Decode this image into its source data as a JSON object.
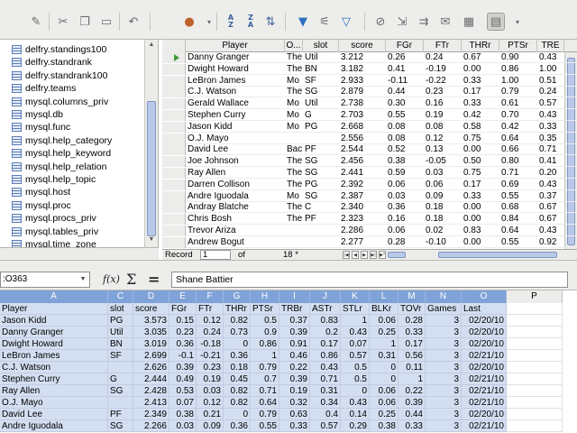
{
  "toolbar": {
    "buttons": [
      {
        "name": "edit-icon",
        "glyph": "✎"
      },
      {
        "name": "cut-icon",
        "glyph": "✂"
      },
      {
        "name": "copy-icon",
        "glyph": "❐"
      },
      {
        "name": "paste-icon",
        "glyph": "📋"
      },
      {
        "name": "undo-icon",
        "glyph": "↶"
      },
      {
        "name": "sort-ascending-icon",
        "glyph": "A↓Z"
      },
      {
        "name": "sort-descending-icon",
        "glyph": "Z↓A"
      },
      {
        "name": "sort-icon",
        "glyph": "⇅"
      },
      {
        "name": "autofilter-icon",
        "glyph": "⏷"
      },
      {
        "name": "standard-filter-icon",
        "glyph": "⏷"
      },
      {
        "name": "remove-filter-icon",
        "glyph": "⊘"
      },
      {
        "name": "toggle-navigator-icon",
        "glyph": "▤"
      }
    ]
  },
  "navigator": {
    "items": [
      "delfry.standings100",
      "delfry.standrank",
      "delfry.standrank100",
      "delfry.teams",
      "mysql.columns_priv",
      "mysql.db",
      "mysql.func",
      "mysql.help_category",
      "mysql.help_keyword",
      "mysql.help_relation",
      "mysql.help_topic",
      "mysql.host",
      "mysql.proc",
      "mysql.procs_priv",
      "mysql.tables_priv",
      "mysql.time_zone"
    ]
  },
  "topgrid": {
    "columns": [
      "Player",
      "O...",
      "slot",
      "score",
      "FGr",
      "FTr",
      "THRr",
      "PTSr",
      "TRE"
    ],
    "rows": [
      [
        "Danny Granger",
        "The",
        "Util",
        "3.212",
        "0.26",
        "0.24",
        "0.67",
        "0.90",
        "0.43"
      ],
      [
        "Dwight Howard",
        "The",
        "BN",
        "3.182",
        "0.41",
        "-0.19",
        "0.00",
        "0.86",
        "1.00"
      ],
      [
        "LeBron James",
        "Mo",
        "SF",
        "2.933",
        "-0.11",
        "-0.22",
        "0.33",
        "1.00",
        "0.51"
      ],
      [
        "C.J. Watson",
        "The",
        "SG",
        "2.879",
        "0.44",
        "0.23",
        "0.17",
        "0.79",
        "0.24"
      ],
      [
        "Gerald Wallace",
        "Mo",
        "Util",
        "2.738",
        "0.30",
        "0.16",
        "0.33",
        "0.61",
        "0.57"
      ],
      [
        "Stephen Curry",
        "Mo",
        "G",
        "2.703",
        "0.55",
        "0.19",
        "0.42",
        "0.70",
        "0.43"
      ],
      [
        "Jason Kidd",
        "Mo",
        "PG",
        "2.668",
        "0.08",
        "0.08",
        "0.58",
        "0.42",
        "0.33"
      ],
      [
        "O.J. Mayo",
        "",
        "",
        "2.556",
        "0.08",
        "0.12",
        "0.75",
        "0.64",
        "0.35"
      ],
      [
        "David Lee",
        "Bac",
        "PF",
        "2.544",
        "0.52",
        "0.13",
        "0.00",
        "0.66",
        "0.71"
      ],
      [
        "Joe Johnson",
        "The",
        "SG",
        "2.456",
        "0.38",
        "-0.05",
        "0.50",
        "0.80",
        "0.41"
      ],
      [
        "Ray Allen",
        "The",
        "SG",
        "2.441",
        "0.59",
        "0.03",
        "0.75",
        "0.71",
        "0.20"
      ],
      [
        "Darren Collison",
        "The",
        "PG",
        "2.392",
        "0.06",
        "0.06",
        "0.17",
        "0.69",
        "0.43"
      ],
      [
        "Andre Iguodala",
        "Mo",
        "SG",
        "2.387",
        "0.03",
        "0.09",
        "0.33",
        "0.55",
        "0.37"
      ],
      [
        "Andray Blatche",
        "The",
        "C",
        "2.340",
        "0.36",
        "0.18",
        "0.00",
        "0.68",
        "0.67"
      ],
      [
        "Chris Bosh",
        "The",
        "PF",
        "2.323",
        "0.16",
        "0.18",
        "0.00",
        "0.84",
        "0.67"
      ],
      [
        "Trevor Ariza",
        "",
        "",
        "2.286",
        "0.06",
        "0.02",
        "0.83",
        "0.64",
        "0.43"
      ],
      [
        "Andrew Bogut",
        "",
        "",
        "2.277",
        "0.28",
        "-0.10",
        "0.00",
        "0.55",
        "0.92"
      ]
    ],
    "status": {
      "record_label": "Record",
      "record_value": "1",
      "of_label": "of",
      "total": "18 *"
    }
  },
  "formula": {
    "namebox": ":O363",
    "fx": "f(x)",
    "sigma": "Σ",
    "equals": "=",
    "value": "Shane Battier"
  },
  "sheet": {
    "col_letters": [
      "A",
      "C",
      "D",
      "E",
      "F",
      "G",
      "H",
      "I",
      "J",
      "K",
      "L",
      "M",
      "N",
      "O",
      "P"
    ],
    "header_row": [
      "Player",
      "slot",
      "score",
      "FGr",
      "FTr",
      "THRr",
      "PTSr",
      "TRBr",
      "ASTr",
      "STLr",
      "BLKr",
      "TOVr",
      "Games",
      "Last"
    ],
    "rows": [
      [
        "Jason Kidd",
        "PG",
        "3.573",
        "0.15",
        "0.12",
        "0.82",
        "0.5",
        "0.37",
        "0.83",
        "1",
        "0.06",
        "0.28",
        "3",
        "02/20/10"
      ],
      [
        "Danny Granger",
        "Util",
        "3.035",
        "0.23",
        "0.24",
        "0.73",
        "0.9",
        "0.39",
        "0.2",
        "0.43",
        "0.25",
        "0.33",
        "3",
        "02/20/10"
      ],
      [
        "Dwight Howard",
        "BN",
        "3.019",
        "0.36",
        "-0.18",
        "0",
        "0.86",
        "0.91",
        "0.17",
        "0.07",
        "1",
        "0.17",
        "3",
        "02/20/10"
      ],
      [
        "LeBron James",
        "SF",
        "2.699",
        "-0.1",
        "-0.21",
        "0.36",
        "1",
        "0.46",
        "0.86",
        "0.57",
        "0.31",
        "0.56",
        "3",
        "02/21/10"
      ],
      [
        "C.J. Watson",
        "",
        "2.626",
        "0.39",
        "0.23",
        "0.18",
        "0.79",
        "0.22",
        "0.43",
        "0.5",
        "0",
        "0.11",
        "3",
        "02/20/10"
      ],
      [
        "Stephen Curry",
        "G",
        "2.444",
        "0.49",
        "0.19",
        "0.45",
        "0.7",
        "0.39",
        "0.71",
        "0.5",
        "0",
        "1",
        "3",
        "02/21/10"
      ],
      [
        "Ray Allen",
        "SG",
        "2.428",
        "0.53",
        "0.03",
        "0.82",
        "0.71",
        "0.19",
        "0.31",
        "0",
        "0.06",
        "0.22",
        "3",
        "02/21/10"
      ],
      [
        "O.J. Mayo",
        "",
        "2.413",
        "0.07",
        "0.12",
        "0.82",
        "0.64",
        "0.32",
        "0.34",
        "0.43",
        "0.06",
        "0.39",
        "3",
        "02/21/10"
      ],
      [
        "David Lee",
        "PF",
        "2.349",
        "0.38",
        "0.21",
        "0",
        "0.79",
        "0.63",
        "0.4",
        "0.14",
        "0.25",
        "0.44",
        "3",
        "02/20/10"
      ],
      [
        "Andre Iguodala",
        "SG",
        "2.266",
        "0.03",
        "0.09",
        "0.36",
        "0.55",
        "0.33",
        "0.57",
        "0.29",
        "0.38",
        "0.33",
        "3",
        "02/21/10"
      ]
    ]
  }
}
